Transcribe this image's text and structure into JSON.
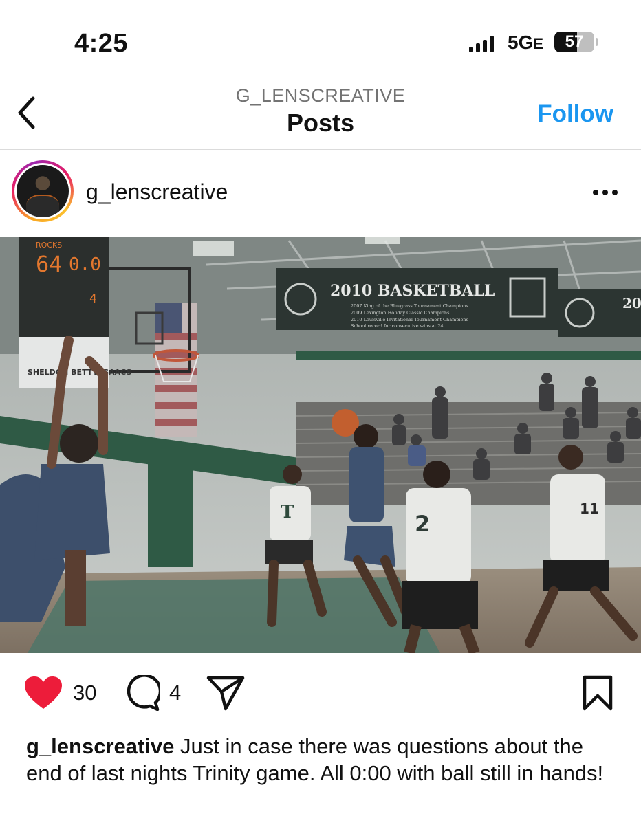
{
  "status_bar": {
    "time": "4:25",
    "network": "5G",
    "network_suffix": "E",
    "battery_level": "57",
    "battery_fraction": 0.57
  },
  "header": {
    "account": "G_LENSCREATIVE",
    "title": "Posts",
    "follow_label": "Follow",
    "back_icon": "chevron-left-icon",
    "accent_color": "#1a96f0"
  },
  "post": {
    "username": "g_lenscreative",
    "more_icon": "ellipsis-icon",
    "photo": {
      "banner_title": "2010 BASKETBALL",
      "banner_lines": [
        "2007 King of the Bluegrass Tournament Champions",
        "2009 Lexington Holiday Classic Champions",
        "2010 Louisville Invitational Tournament Champions",
        "School record for consecutive wins at 24"
      ],
      "banner_title_2": "20",
      "scoreboard_score": "64",
      "scoreboard_clock": "0.0",
      "scoreboard_home": "ROCKS",
      "scoreboard_period": "4",
      "scoreboard_sponsor": "SHELDON   BETTY ISAACS",
      "jersey_t": "T",
      "jersey_2": "2",
      "jersey_11": "11"
    },
    "actions": {
      "like_icon": "heart-icon",
      "like_color": "#ed1c3a",
      "like_count": "30",
      "comment_icon": "comment-icon",
      "comment_count": "4",
      "share_icon": "send-icon",
      "save_icon": "bookmark-icon"
    },
    "caption": {
      "username": "g_lenscreative",
      "text": " Just in case there was questions about the end of last nights Trinity game. All 0:00 with ball still in hands!"
    }
  }
}
